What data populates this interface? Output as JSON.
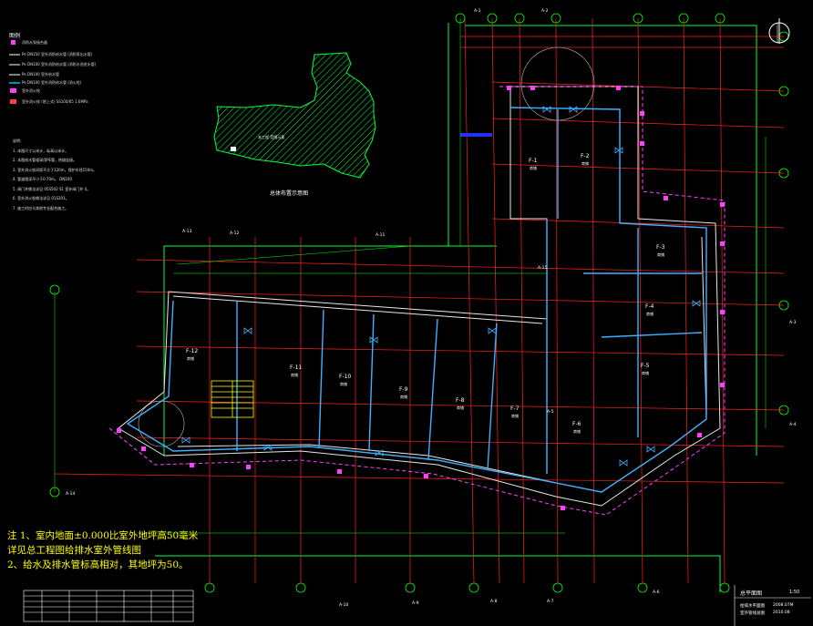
{
  "drawing": {
    "legend": {
      "title": "图例",
      "items": [
        {
          "label": "消防水泵接合器",
          "color": "#ff40ff"
        },
        {
          "label": "Pe  DN150 室外消防给水管 (消防泵出水管)",
          "color": "#ffffff"
        },
        {
          "label": "Pe  DN100 室外消防给水管 (消防水池进水管)",
          "color": "#ffffff"
        },
        {
          "label": "Pe  DN100 室外给水管",
          "color": "#ffffff"
        },
        {
          "label": "Pe  DN100 室外消防给水管 (消火栓)",
          "color": "#00c0ff"
        },
        {
          "label": "室外消火栓",
          "color": "#ff40ff"
        },
        {
          "label": "室外消火栓 (地上式)  SS100/65  1.6MPa",
          "color": "#ff4040"
        }
      ]
    },
    "notes": [
      "说明：",
      "1. 本图尺寸以米计，标高以米计。",
      "2. 本图给水管道采用PE管，热熔连接。",
      "3. 室外消火栓间距不大于120m，保护半径150m。",
      "4. 管道埋深不小于0.70m。      DN100",
      "5. 阀门井做法详见 05S502    S1  室外阀门井    4。",
      "6. 室外消火栓做法详见 01S201。",
      "7. 施工时应与其他专业配合施工。"
    ],
    "key_plan": {
      "caption": "总体布置示意图",
      "label": "本工程    范围示意"
    },
    "zones": [
      {
        "name": "F-1",
        "sub": "商铺"
      },
      {
        "name": "F-2",
        "sub": "商铺"
      },
      {
        "name": "F-3",
        "sub": "商铺"
      },
      {
        "name": "F-4",
        "sub": "商铺"
      },
      {
        "name": "F-5",
        "sub": "商铺"
      },
      {
        "name": "F-6",
        "sub": "商铺"
      },
      {
        "name": "F-7",
        "sub": "商铺"
      },
      {
        "name": "F-8",
        "sub": "商铺"
      },
      {
        "name": "F-9",
        "sub": "商铺"
      },
      {
        "name": "F-10",
        "sub": "商铺"
      },
      {
        "name": "F-11",
        "sub": "商铺"
      },
      {
        "name": "F-12",
        "sub": "商铺"
      }
    ],
    "axis_labels": [
      "A-1",
      "A-2",
      "A-3",
      "A-4",
      "A-5",
      "A-6",
      "A-7",
      "A-8",
      "A-9",
      "A-10",
      "A-11",
      "A-12",
      "A-13",
      "A-14",
      "A-15"
    ],
    "big_notes": [
      "注 1、室内地面±0.000比室外地坪高50毫米",
      "    详见总工程图给排水室外管线图",
      "  2、给水及排水管标高相对，其地坪为50。"
    ],
    "sheet": {
      "title": "总平面图",
      "scale": "1:50",
      "info1": "给排水平面图",
      "info2": "室外管线总图",
      "code": "2008.07M",
      "date": "2010.08"
    },
    "colors": {
      "background": "#000000",
      "grid_axis": "#ff2020",
      "building": "#00ff40",
      "water_pipe": "#40b0ff",
      "fire_pipe": "#ff40ff",
      "text": "#ffffff",
      "note": "#ffff00",
      "dimension": "#00ff00"
    },
    "icons": {
      "north": "north-arrow-icon"
    }
  }
}
